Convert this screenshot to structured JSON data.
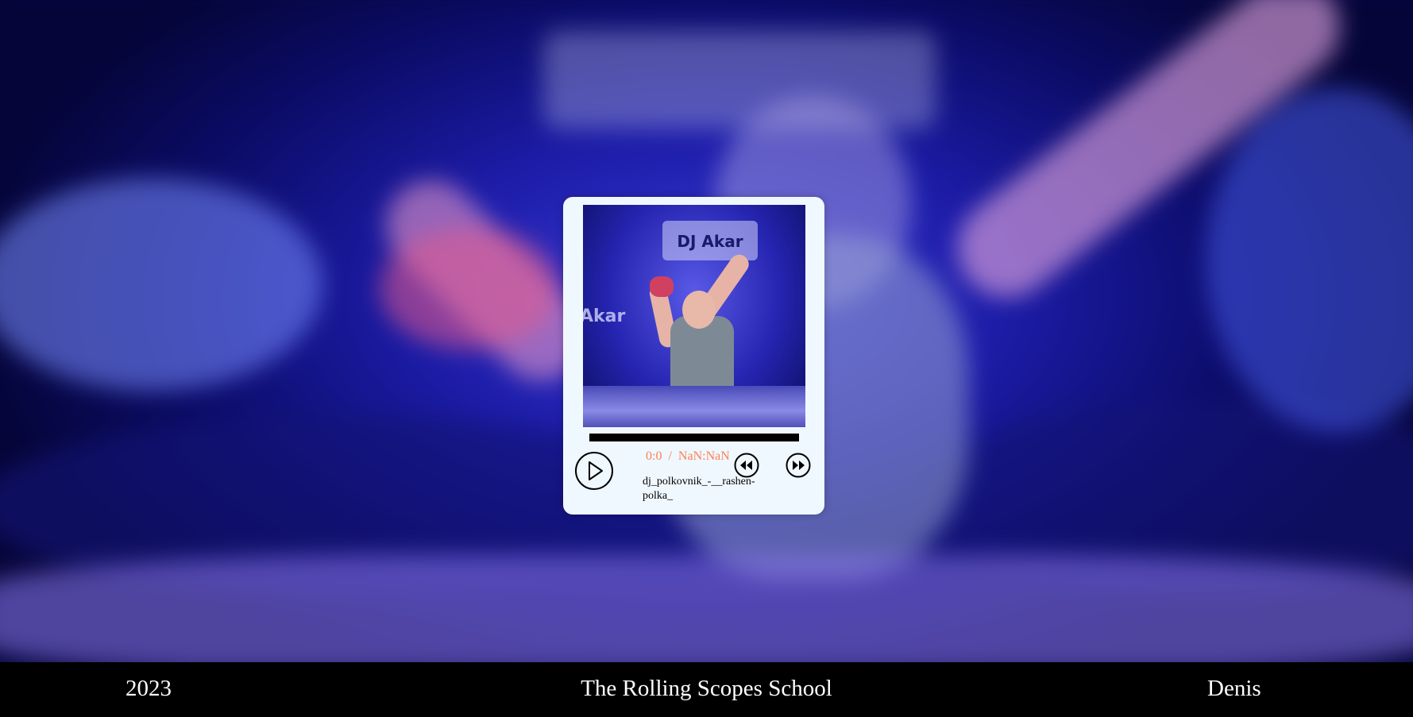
{
  "player": {
    "time": {
      "current": "0:0",
      "separator": "/",
      "duration": "NaN:NaN"
    },
    "track_title": "dj_polkovnik_-__rashen-polka_",
    "progress": 0,
    "cover_text": {
      "sign": "DJ Akar",
      "side": "Akar"
    },
    "icons": {
      "play": "play-icon",
      "prev": "rewind-icon",
      "next": "fast-forward-icon"
    },
    "colors": {
      "card": "#f0f8ff",
      "time": "#ff7f50",
      "progress_track": "#000000"
    }
  },
  "footer": {
    "year": "2023",
    "school": "The Rolling Scopes School",
    "author": "Denis"
  }
}
